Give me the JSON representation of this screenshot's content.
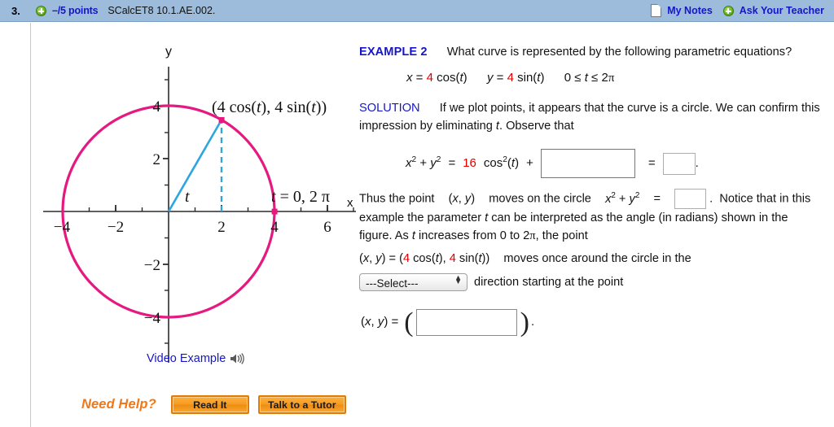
{
  "header": {
    "question_number": "3.",
    "points": "–/5 points",
    "question_code": "SCalcET8 10.1.AE.002.",
    "my_notes": "My Notes",
    "ask_teacher": "Ask Your Teacher",
    "bar_color": "#9dbcdc",
    "link_color": "#1616c8"
  },
  "problem": {
    "example_label": "EXAMPLE 2",
    "prompt": "What curve is represented by the following parametric equations?",
    "equation": {
      "x_lhs": "x",
      "eq": "=",
      "x_coef": "4",
      "x_fn": "cos(t)",
      "y_lhs": "y",
      "y_coef": "4",
      "y_fn": "sin(t)",
      "range": "0 ≤ t ≤ 2π"
    },
    "solution_label": "SOLUTION",
    "solution_text": "If we plot points, it appears that the curve is a circle. We can confirm this impression by eliminating t. Observe that",
    "identity": {
      "lhs": "x2 + y2",
      "eq1": "=",
      "coef": "16",
      "term": "cos2(t)",
      "plus": "+",
      "eq2": "=",
      "period": "."
    },
    "thus_1": "Thus the point",
    "thus_pt": "(x, y)",
    "thus_2": "moves on the circle",
    "thus_circle_lhs": "x2 + y2",
    "thus_eq": "=",
    "notice_text": ".  Notice that in this example the parameter t can be interpreted as the angle (in radians) shown in the figure. As t increases from 0 to 2π, the point",
    "point_line_lhs": "(x, y)  =  (",
    "point_coef1": "4",
    "point_fn1": "cos(t),",
    "point_coef2": "4",
    "point_fn2": "sin(t))",
    "point_line_tail": "moves once around the circle in the",
    "select_value": "---Select---",
    "direction_tail": "direction starting at the point",
    "final_lhs": "(x, y)  =",
    "final_tail": "."
  },
  "figure": {
    "y_axis_label": "y",
    "x_axis_label": "x",
    "point_label": "(4 cos(t), 4 sin(t))",
    "t_label": "t",
    "t_start_label": "t = 0, 2 π",
    "x_ticks": [
      "−4",
      "−2",
      "2",
      "4",
      "6"
    ],
    "y_ticks": [
      "4",
      "2",
      "−2",
      "−4"
    ],
    "curve_color": "#e5197f",
    "radius_color": "#2ba6e0",
    "video_example": "Video Example"
  },
  "footer": {
    "need_help": "Need Help?",
    "read_it": "Read It",
    "talk_tutor": "Talk to a Tutor",
    "button_color": "#f79b22"
  },
  "chart_data": {
    "type": "line",
    "title": "Parametric circle x = 4cos(t), y = 4sin(t)",
    "xlabel": "x",
    "ylabel": "y",
    "xlim": [
      -5.2,
      7.4
    ],
    "ylim": [
      -5.2,
      5.4
    ],
    "grid": false,
    "legend": "none",
    "circle": {
      "center": [
        0,
        0
      ],
      "radius": 4
    },
    "x_tick_values": [
      -4,
      -2,
      2,
      4,
      6
    ],
    "y_tick_values": [
      4,
      2,
      -2,
      -4
    ],
    "markers": [
      {
        "label": "(4 cos(t), 4 sin(t))",
        "x": 2,
        "y": 3.46
      },
      {
        "label": "t = 0, 2 π",
        "x": 4,
        "y": 0
      }
    ],
    "radius_segment": {
      "from": [
        0,
        0
      ],
      "to": [
        2,
        3.46
      ]
    },
    "dashed_segment": {
      "from": [
        2,
        0
      ],
      "to": [
        2,
        3.46
      ]
    },
    "angle_label": "t"
  }
}
